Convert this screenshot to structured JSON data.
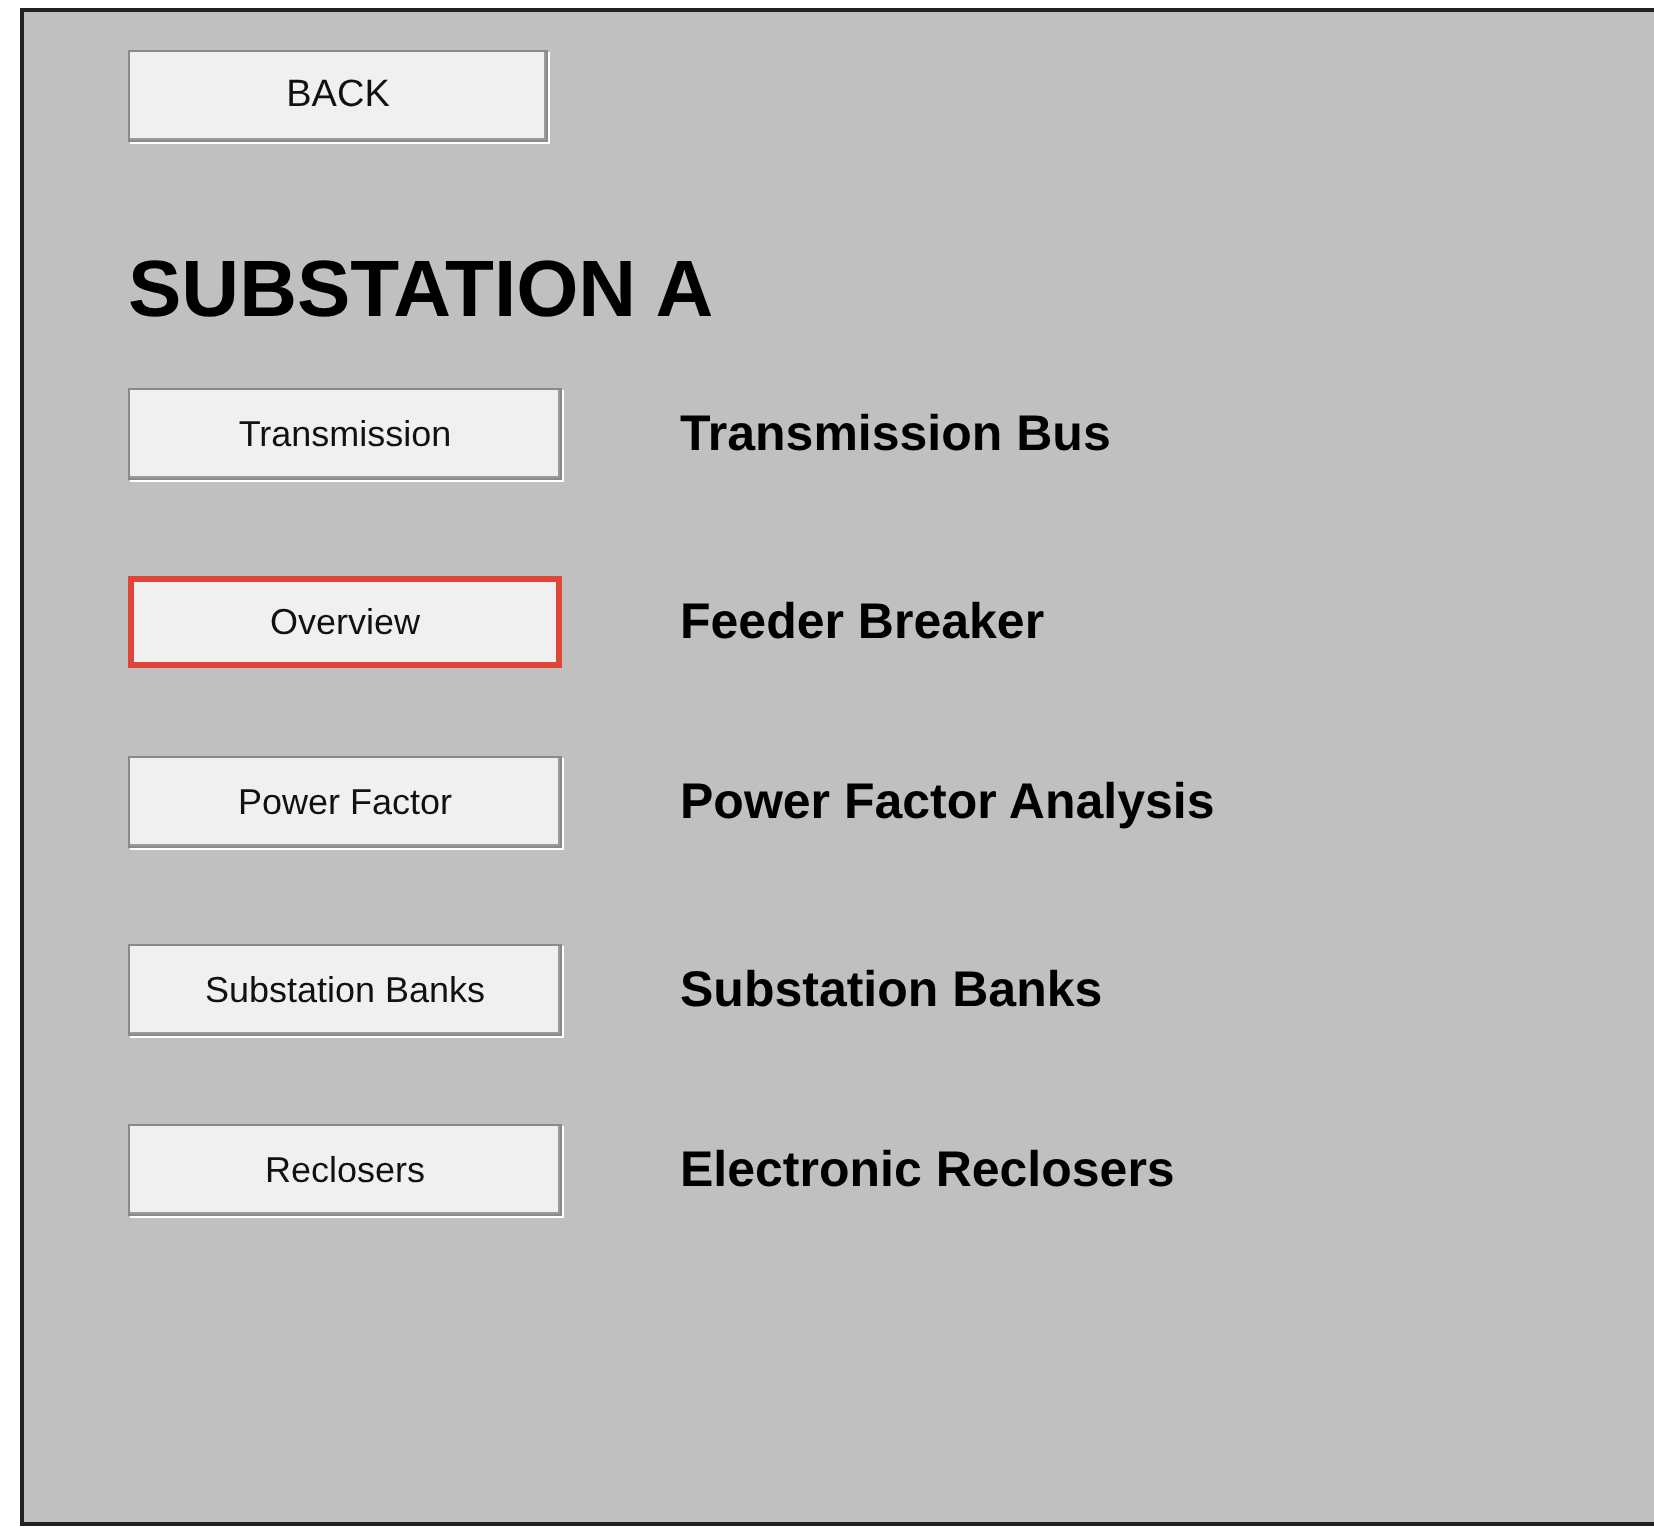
{
  "back_button": {
    "label": "BACK"
  },
  "title": "SUBSTATION A",
  "rows": [
    {
      "button": "Transmission",
      "label": "Transmission Bus",
      "selected": false
    },
    {
      "button": "Overview",
      "label": "Feeder Breaker",
      "selected": true
    },
    {
      "button": "Power Factor",
      "label": "Power Factor Analysis",
      "selected": false
    },
    {
      "button": "Substation Banks",
      "label": "Substation Banks",
      "selected": false
    },
    {
      "button": "Reclosers",
      "label": "Electronic Reclosers",
      "selected": false
    }
  ]
}
